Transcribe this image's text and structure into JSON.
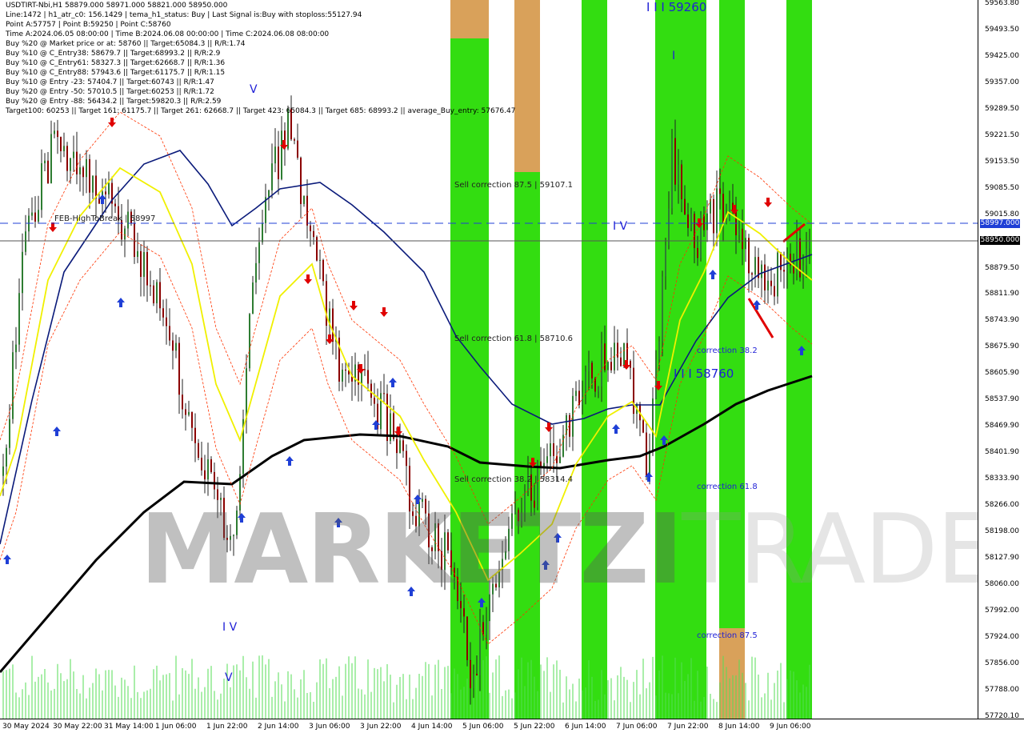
{
  "header": {
    "lines": [
      "USDTIRT-Nbi,H1  58879.000 58971.000 58821.000 58950.000",
      "Line:1472 | h1_atr_c0: 156.1429 | tema_h1_status: Buy | Last Signal is:Buy with stoploss:55127.94",
      "Point A:57757 | Point B:59250 | Point C:58760",
      "Time A:2024.06.05 08:00:00 | Time B:2024.06.08 00:00:00 | Time C:2024.06.08 08:00:00",
      "Buy %20 @ Market price or at: 58760 || Target:65084.3 || R/R:1.74",
      "Buy %10 @ C_Entry38: 58679.7 || Target:68993.2 || R/R:2.9",
      "Buy %10 @ C_Entry61: 58327.3 || Target:62668.7 || R/R:1.36",
      "Buy %10 @ C_Entry88: 57943.6 || Target:61175.7 || R/R:1.15",
      "Buy %10 @ Entry -23: 57404.7 || Target:60743 || R/R:1.47",
      "Buy %20 @ Entry -50: 57010.5 || Target:60253 || R/R:1.72",
      "Buy %20 @ Entry -88: 56434.2 || Target:59820.3 || R/R:2.59",
      "Target100: 60253 || Target 161: 61175.7 || Target 261: 62668.7 || Target 423: 65084.3 || Target 685: 68993.2 || average_Buy_entry: 57676.47"
    ]
  },
  "zones": {
    "sell_correction_875": "Sell correction 87.5 | 59107.1",
    "sell_correction_618": "Sell correction 61.8 | 58710.6",
    "sell_correction_382": "Sell correction 38.2 | 58314.4",
    "correction_382": "correction 38.2",
    "correction_618": "correction 61.8",
    "correction_875": "correction 87.5",
    "level_c": "I I I 58760",
    "level_b": "I I I 59260",
    "feb_high": "FEB-HighToBreak | 58997"
  },
  "wave_labels": [
    "I V",
    "V",
    "I V",
    "V",
    "I"
  ],
  "watermark": {
    "dark": "MARKETZI",
    "light": "TRADE"
  },
  "price_axis": {
    "ticks": [
      "59563.80",
      "59493.50",
      "59425.00",
      "59357.00",
      "59289.50",
      "59221.50",
      "59153.50",
      "59085.50",
      "59015.80",
      "58879.50",
      "58811.90",
      "58743.90",
      "58675.90",
      "58605.90",
      "58537.90",
      "58469.90",
      "58401.90",
      "58333.90",
      "58266.00",
      "58198.00",
      "58127.90",
      "58060.00",
      "57992.00",
      "57924.00",
      "57856.00",
      "57788.00",
      "57720.10"
    ],
    "badge_blue": "58997.000",
    "badge_current": "58950.000"
  },
  "time_axis": [
    "30 May 2024",
    "30 May 22:00",
    "31 May 14:00",
    "1 Jun 06:00",
    "1 Jun 22:00",
    "2 Jun 14:00",
    "3 Jun 06:00",
    "3 Jun 22:00",
    "4 Jun 14:00",
    "5 Jun 06:00",
    "5 Jun 22:00",
    "6 Jun 14:00",
    "7 Jun 06:00",
    "7 Jun 22:00",
    "8 Jun 14:00",
    "9 Jun 06:00"
  ],
  "colors": {
    "bull": "#2e7d32",
    "bear": "#8b0000",
    "green_band": "#33dd11",
    "orange_band": "#d9a15a",
    "ma_navy": "#0a1a7a",
    "ma_black": "#000000",
    "ma_yellow": "#f0f000",
    "envelope": "#ff3300",
    "buy_arrow": "#1f3fd6",
    "sell_arrow": "#e00000",
    "volume": "#55dd55"
  }
}
